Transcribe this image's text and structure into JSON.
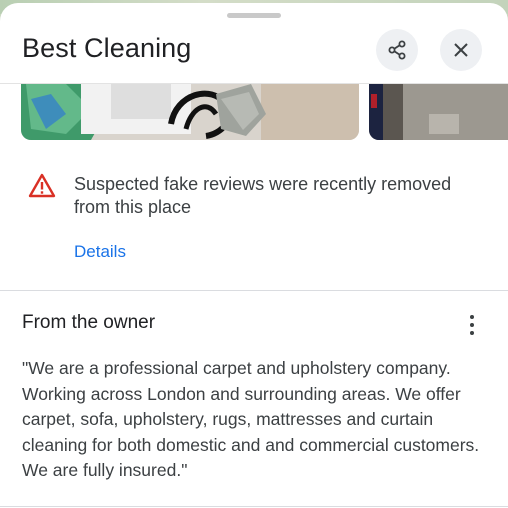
{
  "header": {
    "title": "Best Cleaning",
    "share_icon": "share-icon",
    "close_icon": "close-icon"
  },
  "warning": {
    "icon": "warning-triangle-icon",
    "message": "Suspected fake reviews were recently removed from this place",
    "link": "Details",
    "link_color": "#1a73e8",
    "icon_color": "#d93025"
  },
  "owner": {
    "section_title": "From the owner",
    "menu_icon": "more-vert-icon",
    "description": "\"We are a professional carpet and upholstery company. Working across London and surrounding areas. We offer carpet, sofa, upholstery, rugs, mattresses and curtain cleaning for both domestic and and commercial customers. We are fully insured.\""
  }
}
